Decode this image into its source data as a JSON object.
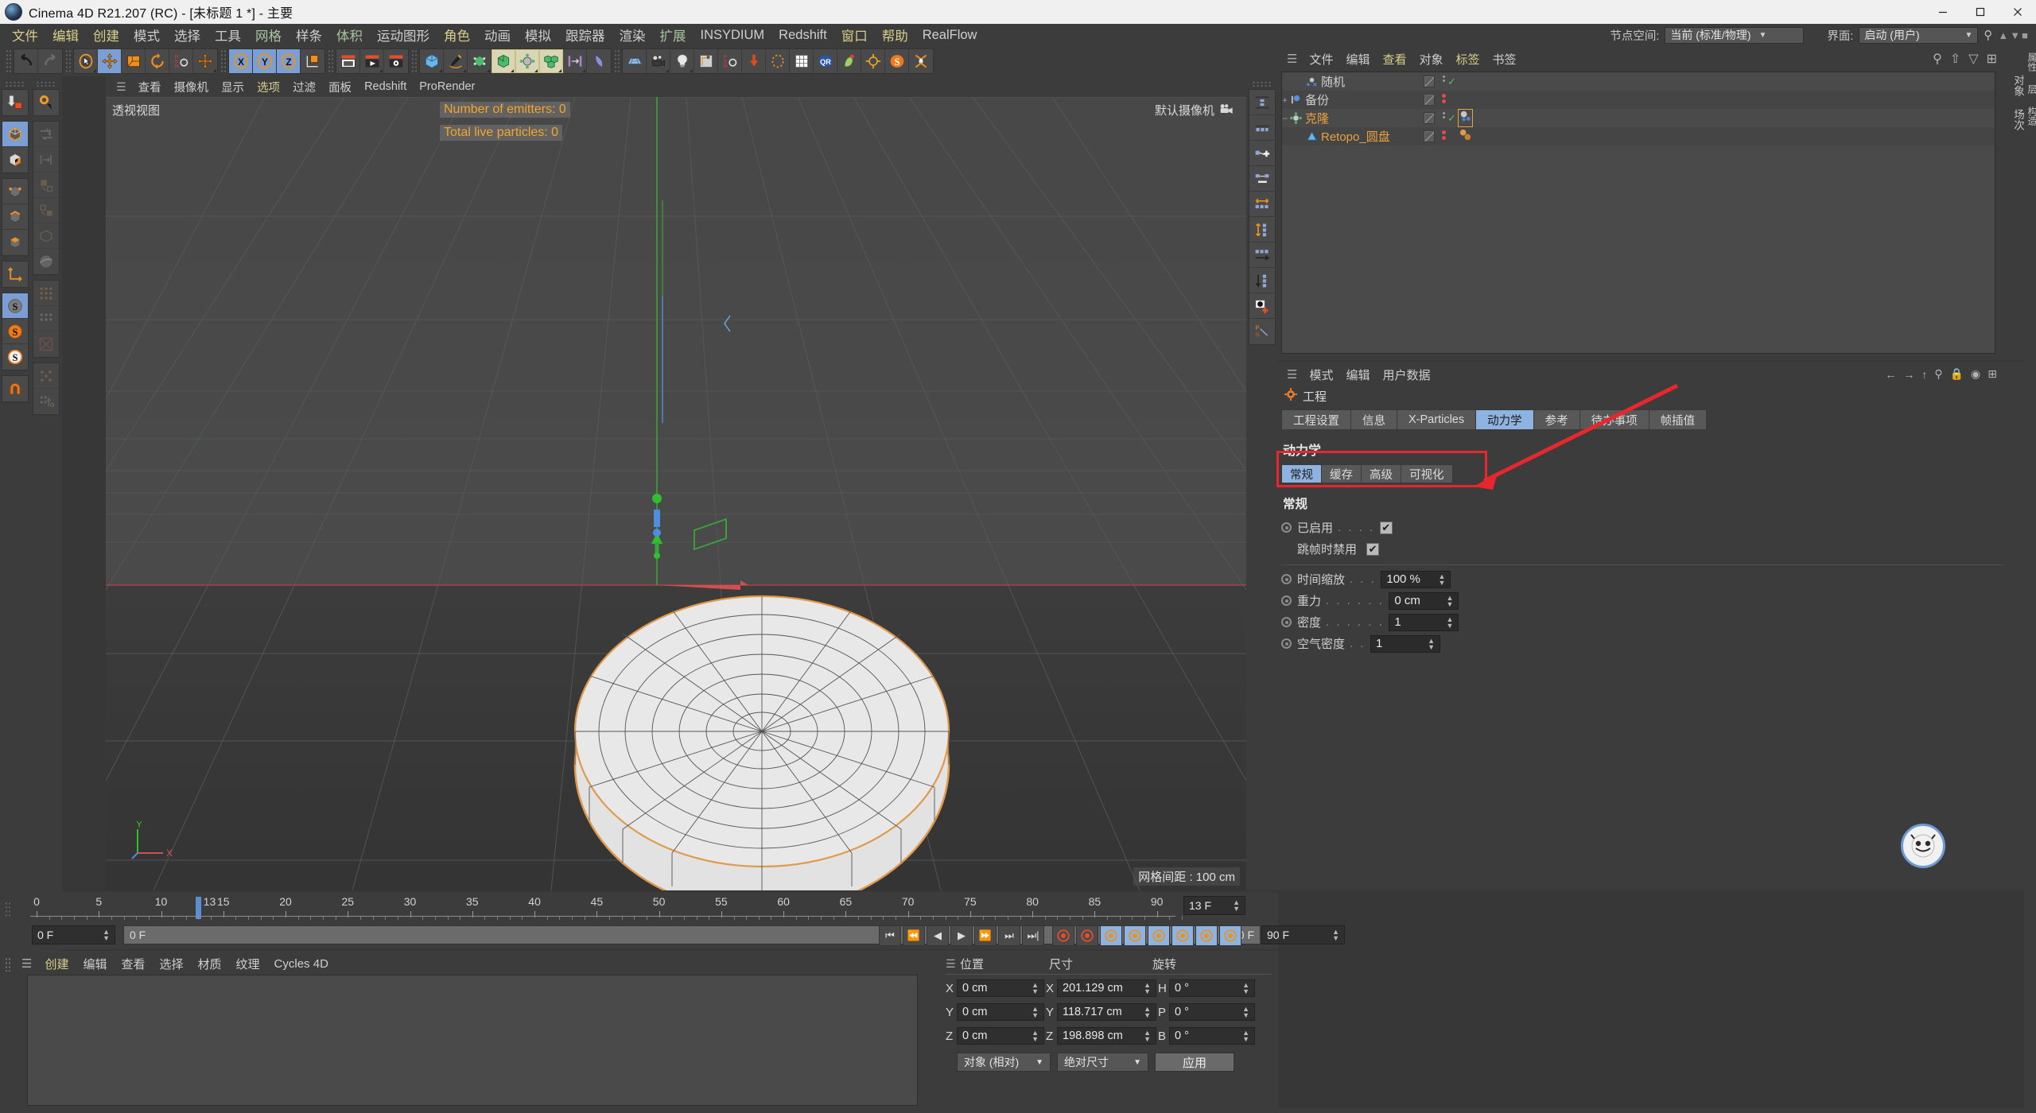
{
  "window": {
    "title": "Cinema 4D R21.207 (RC) - [未标题 1 *] - 主要",
    "app_icon": "c4d-logo-icon",
    "minimize": "–",
    "maximize": "▢",
    "close": "✕"
  },
  "menubar": {
    "items": [
      {
        "label": "文件",
        "style": "y"
      },
      {
        "label": "编辑",
        "style": "y"
      },
      {
        "label": "创建",
        "style": "y"
      },
      {
        "label": "模式",
        "style": "n"
      },
      {
        "label": "选择",
        "style": "n"
      },
      {
        "label": "工具",
        "style": "n"
      },
      {
        "label": "网格",
        "style": "g"
      },
      {
        "label": "样条",
        "style": "n"
      },
      {
        "label": "体积",
        "style": "g"
      },
      {
        "label": "运动图形",
        "style": "n"
      },
      {
        "label": "角色",
        "style": "y"
      },
      {
        "label": "动画",
        "style": "n"
      },
      {
        "label": "模拟",
        "style": "n"
      },
      {
        "label": "跟踪器",
        "style": "n"
      },
      {
        "label": "渲染",
        "style": "n"
      },
      {
        "label": "扩展",
        "style": "g"
      },
      {
        "label": "INSYDIUM",
        "style": "n"
      },
      {
        "label": "Redshift",
        "style": "n"
      },
      {
        "label": "窗口",
        "style": "y"
      },
      {
        "label": "帮助",
        "style": "y"
      },
      {
        "label": "RealFlow",
        "style": "n"
      }
    ]
  },
  "nodespace": {
    "label": "节点空间:",
    "value": "当前 (标准/物理)",
    "layout_label": "界面:",
    "layout_value": "启动 (用户)",
    "search_icon": "search-icon"
  },
  "viewport": {
    "menu": [
      {
        "label": "查看",
        "style": "n"
      },
      {
        "label": "摄像机",
        "style": "n"
      },
      {
        "label": "显示",
        "style": "n"
      },
      {
        "label": "选项",
        "style": "y"
      },
      {
        "label": "过滤",
        "style": "n"
      },
      {
        "label": "面板",
        "style": "n"
      },
      {
        "label": "Redshift",
        "style": "n"
      },
      {
        "label": "ProRender",
        "style": "n"
      }
    ],
    "view_name": "透视视图",
    "camera_name": "默认摄像机",
    "camera_icon": "camera-icon",
    "hud_lines": [
      "Number of emitters: 0",
      "Total live particles: 0"
    ],
    "grid_info": "网格间距 : 100 cm",
    "axis_x": "X",
    "axis_y": "Y"
  },
  "timeline": {
    "ticks": [
      "0",
      "5",
      "10",
      "15",
      "20",
      "25",
      "30",
      "35",
      "40",
      "45",
      "50",
      "55",
      "60",
      "65",
      "70",
      "75",
      "80",
      "85",
      "90"
    ],
    "playhead_label": "13",
    "current_frame_field": "13 F",
    "start_field": "0 F",
    "range_start": "0 F",
    "range_end": "90 F",
    "end_field": "90 F",
    "transport": [
      "⏮",
      "⏪",
      "◀",
      "▶",
      "⏩",
      "⏭",
      "⏭|"
    ],
    "record_buttons": [
      "record-icon",
      "autokey-icon",
      "position-key-icon",
      "scale-key-icon",
      "rotation-key-icon",
      "param-key-icon",
      "point-key-icon",
      "keyframe-icon"
    ]
  },
  "material_manager": {
    "menu": [
      {
        "label": "创建",
        "style": "y"
      },
      {
        "label": "编辑",
        "style": "n"
      },
      {
        "label": "查看",
        "style": "n"
      },
      {
        "label": "选择",
        "style": "n"
      },
      {
        "label": "材质",
        "style": "n"
      },
      {
        "label": "纹理",
        "style": "n"
      },
      {
        "label": "Cycles 4D",
        "style": "n"
      }
    ]
  },
  "coordinates": {
    "headers": [
      "位置",
      "尺寸",
      "旋转"
    ],
    "rows": [
      {
        "axis1": "X",
        "position": "0 cm",
        "axis2": "X",
        "size": "201.129 cm",
        "axis3": "H",
        "rotation": "0 °"
      },
      {
        "axis1": "Y",
        "position": "0 cm",
        "axis2": "Y",
        "size": "118.717 cm",
        "axis3": "P",
        "rotation": "0 °"
      },
      {
        "axis1": "Z",
        "position": "0 cm",
        "axis2": "Z",
        "size": "198.898 cm",
        "axis3": "B",
        "rotation": "0 °"
      }
    ],
    "mode_select": "对象 (相对)",
    "size_select": "绝对尺寸",
    "apply_button": "应用"
  },
  "object_manager": {
    "menu": [
      {
        "label": "文件",
        "style": "n"
      },
      {
        "label": "编辑",
        "style": "n"
      },
      {
        "label": "查看",
        "style": "y"
      },
      {
        "label": "对象",
        "style": "n"
      },
      {
        "label": "标签",
        "style": "y"
      },
      {
        "label": "书签",
        "style": "n"
      }
    ],
    "tools": [
      "search-icon",
      "up-arrow-icon",
      "filter-icon",
      "expand-icon"
    ],
    "side_tabs": [
      "对象",
      "场次"
    ],
    "rows": [
      {
        "name": "随机",
        "icon": "random-effector-icon",
        "indent": 1,
        "color": "#cfcfcf",
        "expander": "",
        "check": "✓",
        "tags": []
      },
      {
        "name": "备份",
        "icon": "null-object-icon",
        "indent": 0,
        "color": "#cfcfcf",
        "expander": "+",
        "check": "",
        "tags": []
      },
      {
        "name": "克隆",
        "icon": "cloner-icon",
        "indent": 0,
        "color": "#e8a33d",
        "expander": "−",
        "check": "✓",
        "tags": [
          "cloner-tag-icon"
        ]
      },
      {
        "name": "Retopo_圆盘",
        "icon": "polygon-object-icon",
        "indent": 1,
        "color": "#e8a33d",
        "expander": "",
        "check": "",
        "tags": [
          "dynamics-tag-icon"
        ]
      }
    ]
  },
  "attribute_manager": {
    "menu": [
      {
        "label": "模式",
        "style": "n"
      },
      {
        "label": "编辑",
        "style": "n"
      },
      {
        "label": "用户数据",
        "style": "n"
      }
    ],
    "tools": [
      "back-arrow-icon",
      "forward-arrow-icon",
      "up-arrow-icon",
      "search-icon",
      "lock-icon",
      "target-icon",
      "expand-icon"
    ],
    "side_tabs": [
      "属性",
      "层",
      "构造"
    ],
    "object_title": "工程",
    "object_icon": "project-icon",
    "tabs": [
      {
        "label": "工程设置",
        "active": false
      },
      {
        "label": "信息",
        "active": false
      },
      {
        "label": "X-Particles",
        "active": false
      },
      {
        "label": "动力学",
        "active": true
      },
      {
        "label": "参考",
        "active": false
      },
      {
        "label": "待办事项",
        "active": false
      },
      {
        "label": "帧插值",
        "active": false
      }
    ],
    "section_heading": "动力学",
    "subtabs": [
      {
        "label": "常规",
        "active": true
      },
      {
        "label": "缓存",
        "active": false
      },
      {
        "label": "高级",
        "active": false
      },
      {
        "label": "可视化",
        "active": false
      }
    ],
    "group_label": "常规",
    "properties": [
      {
        "id": "enabled",
        "radio": true,
        "label": "已启用",
        "dots": ". . . .",
        "type": "checkbox",
        "value": "✔"
      },
      {
        "id": "skip_frames",
        "radio": false,
        "label": "跳帧时禁用",
        "dots": "",
        "type": "checkbox",
        "value": "✔"
      },
      {
        "id": "time_scale",
        "radio": true,
        "label": "时间缩放",
        "dots": ". . .",
        "type": "field",
        "value": "100 %"
      },
      {
        "id": "gravity",
        "radio": true,
        "label": "重力",
        "dots": ". . . . . .",
        "type": "field",
        "value": "0 cm"
      },
      {
        "id": "density",
        "radio": true,
        "label": "密度",
        "dots": ". . . . . .",
        "type": "field",
        "value": "1"
      },
      {
        "id": "air_density",
        "radio": true,
        "label": "空气密度",
        "dots": ". .",
        "type": "field",
        "value": "1"
      }
    ],
    "annotation": {
      "highlight_target": "gravity",
      "color": "#e7272d",
      "arrow": "red-arrow-annotation"
    }
  }
}
